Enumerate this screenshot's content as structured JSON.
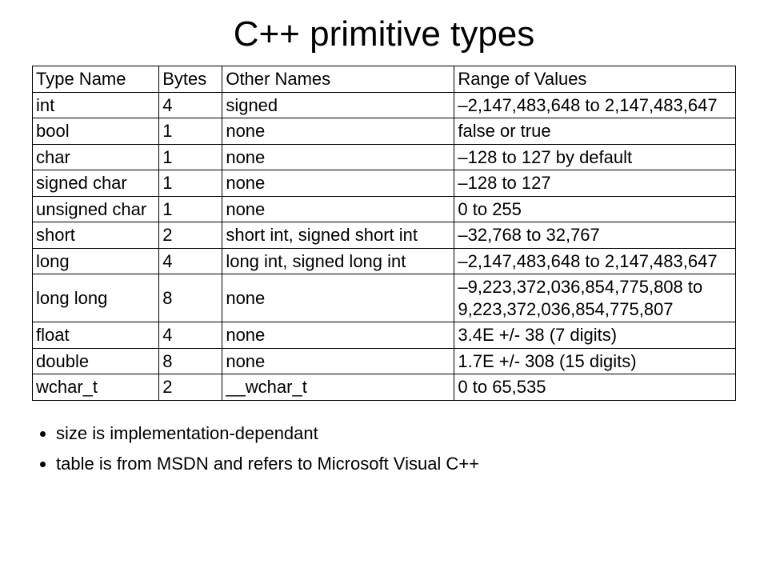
{
  "title": "C++ primitive types",
  "headers": [
    "Type Name",
    "Bytes",
    "Other Names",
    "Range of Values"
  ],
  "rows": [
    {
      "name": "int",
      "bytes": "4",
      "other": "signed",
      "range": "–2,147,483,648 to 2,147,483,647"
    },
    {
      "name": "bool",
      "bytes": "1",
      "other": "none",
      "range": "false or true"
    },
    {
      "name": "char",
      "bytes": "1",
      "other": "none",
      "range": "–128 to 127 by default"
    },
    {
      "name": "signed char",
      "bytes": "1",
      "other": "none",
      "range": "–128 to 127"
    },
    {
      "name": "unsigned char",
      "bytes": "1",
      "other": "none",
      "range": "0 to 255"
    },
    {
      "name": "short",
      "bytes": "2",
      "other": "short int, signed short int",
      "range": "–32,768 to 32,767"
    },
    {
      "name": "long",
      "bytes": "4",
      "other": "long int, signed long int",
      "range": "–2,147,483,648 to 2,147,483,647"
    },
    {
      "name": "long long",
      "bytes": "8",
      "other": "none",
      "range": "–9,223,372,036,854,775,808 to 9,223,372,036,854,775,807"
    },
    {
      "name": "float",
      "bytes": "4",
      "other": "none",
      "range": "3.4E +/- 38 (7 digits)"
    },
    {
      "name": "double",
      "bytes": "8",
      "other": "none",
      "range": "1.7E +/- 308 (15 digits)"
    },
    {
      "name": "wchar_t",
      "bytes": "2",
      "other": "__wchar_t",
      "range": "0 to 65,535"
    }
  ],
  "bullets": [
    "size is implementation-dependant",
    "table is from MSDN and refers to Microsoft Visual C++"
  ]
}
